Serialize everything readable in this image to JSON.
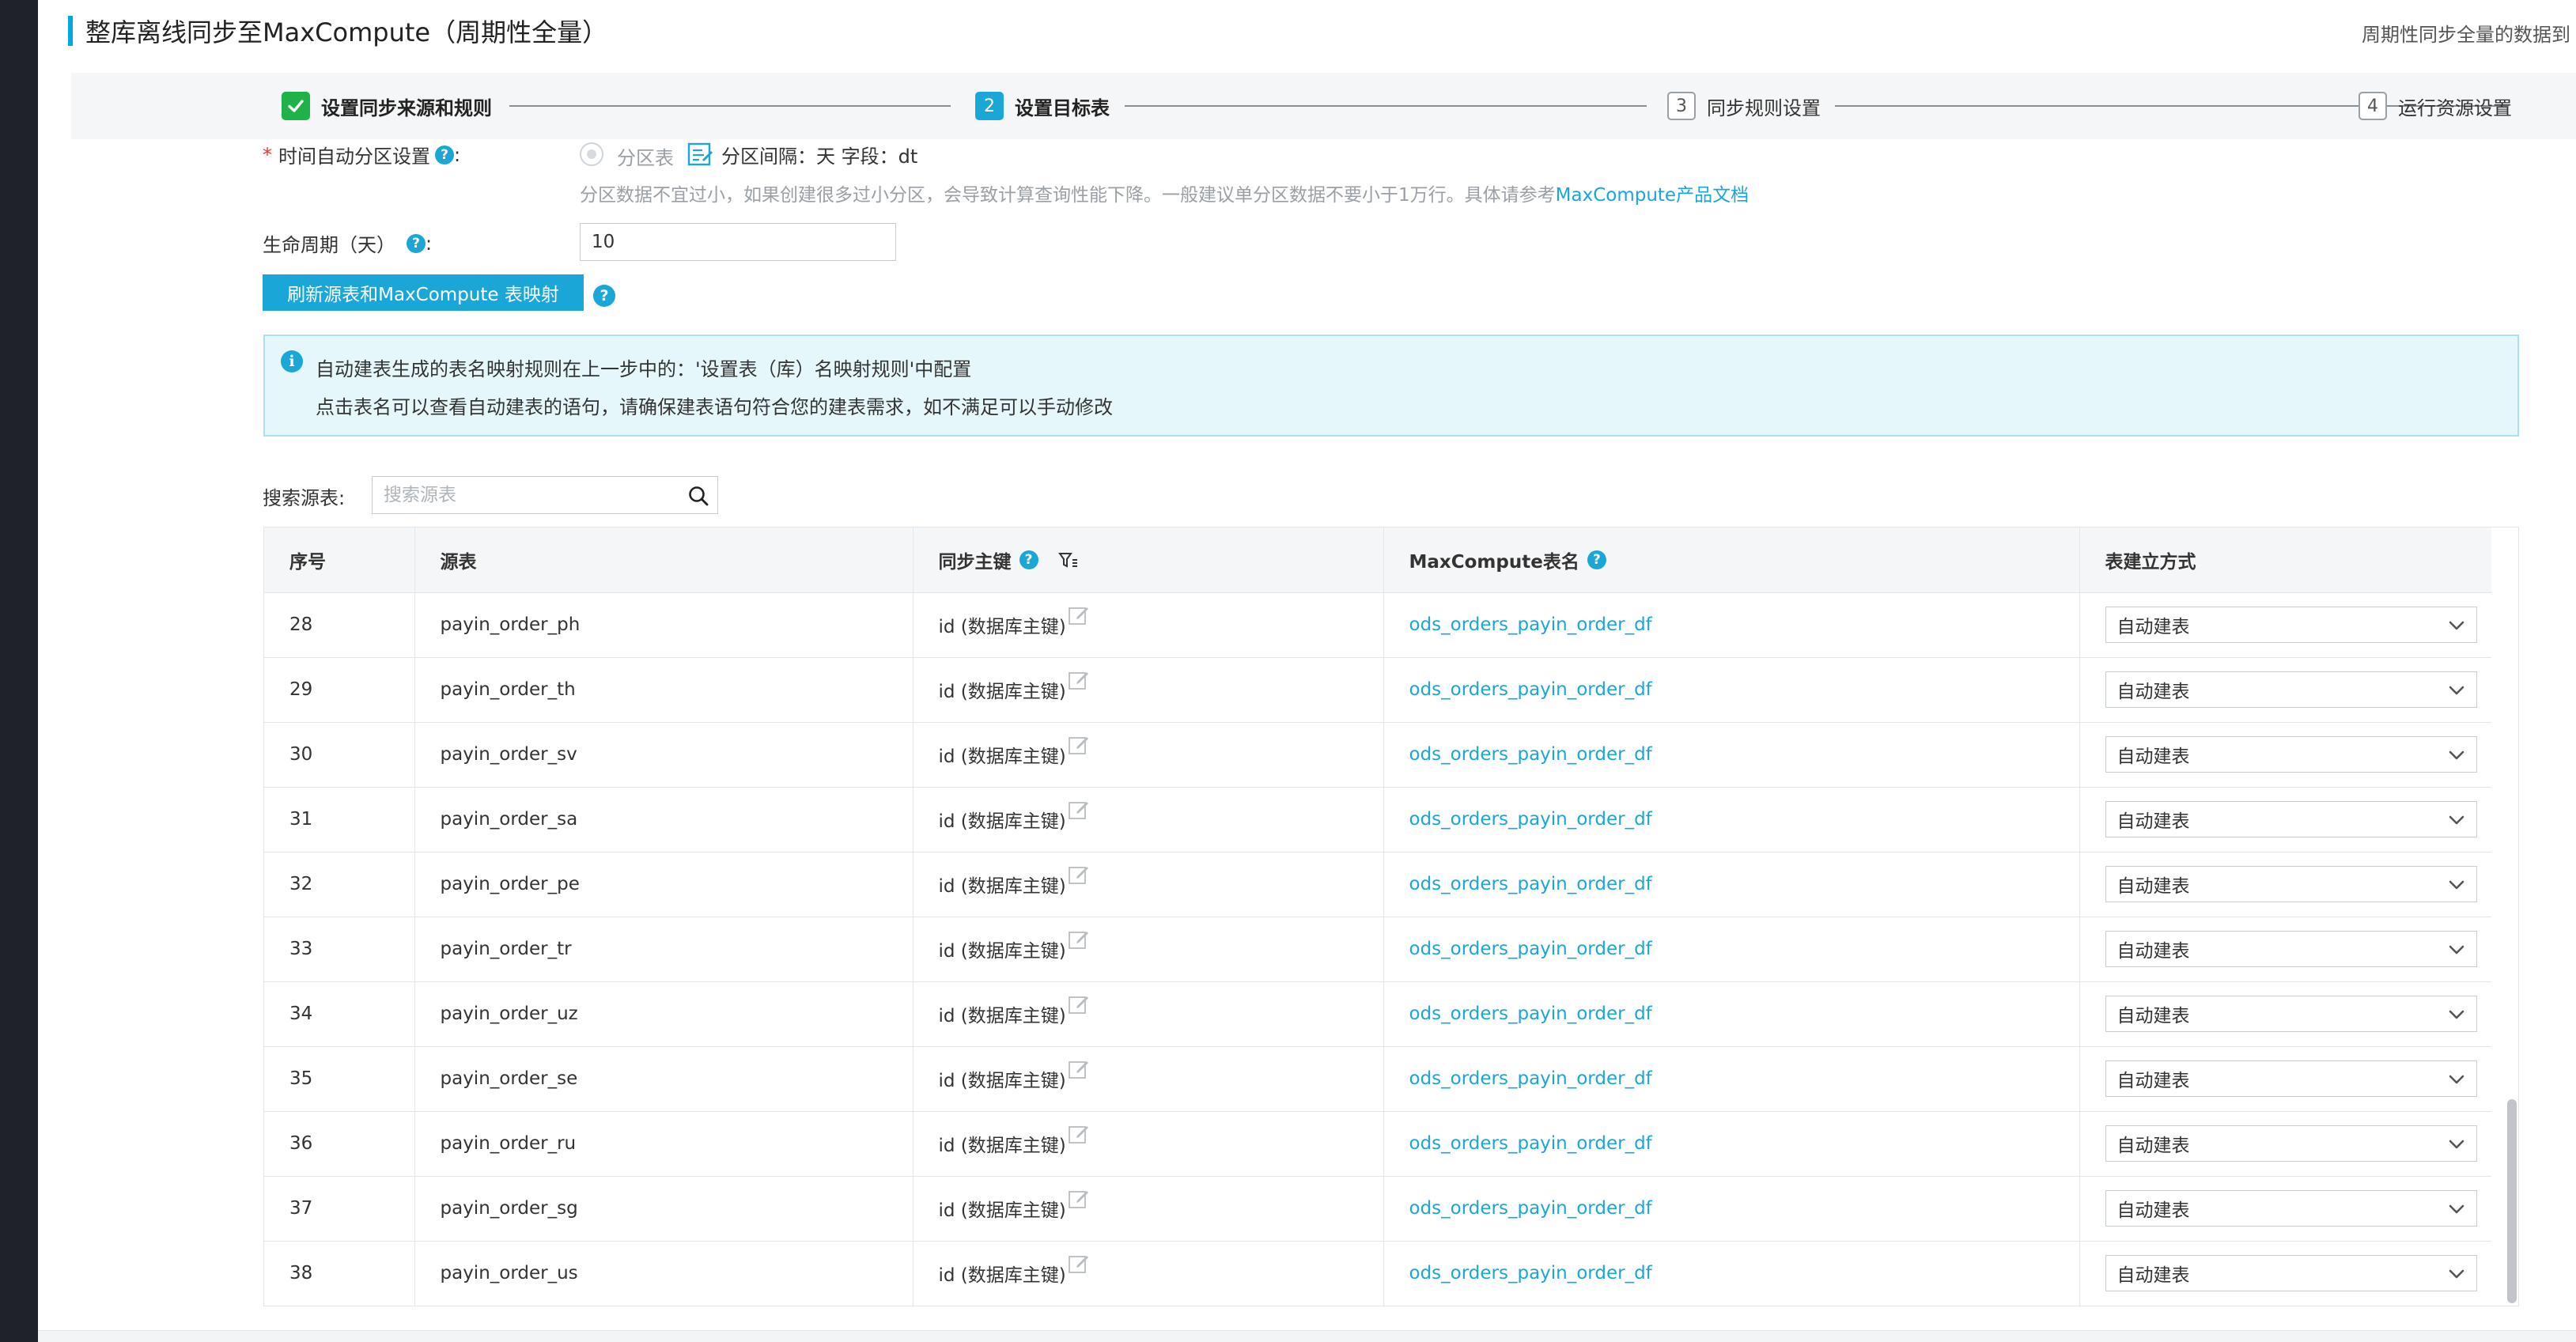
{
  "header": {
    "title": "整库离线同步至MaxCompute（周期性全量）",
    "description": "周期性同步全量的数据到"
  },
  "steps": [
    {
      "number": "",
      "label": "设置同步来源和规则",
      "state": "done"
    },
    {
      "number": "2",
      "label": "设置目标表",
      "state": "active"
    },
    {
      "number": "3",
      "label": "同步规则设置",
      "state": "idle"
    },
    {
      "number": "4",
      "label": "运行资源设置",
      "state": "idle"
    }
  ],
  "form": {
    "partition": {
      "required_mark": "*",
      "label": "时间自动分区设置",
      "colon": ":",
      "radio_label": "分区表",
      "info": "分区间隔：天   字段：dt",
      "tip_text": "分区数据不宜过小，如果创建很多过小分区，会导致计算查询性能下降。一般建议单分区数据不要小于1万行。具体请参考",
      "tip_link": "MaxCompute产品文档"
    },
    "lifecycle": {
      "label": "生命周期（天）",
      "colon": ":",
      "value": "10"
    },
    "refresh_button": "刷新源表和MaxCompute 表映射",
    "help_glyph": "?"
  },
  "alert": {
    "icon_glyph": "i",
    "line1": "自动建表生成的表名映射规则在上一步中的：'设置表（库）名映射规则'中配置",
    "line2": "点击表名可以查看自动建表的语句，请确保建表语句符合您的建表需求，如不满足可以手动修改"
  },
  "search": {
    "label": "搜索源表:",
    "placeholder": "搜索源表",
    "value": ""
  },
  "table": {
    "columns": {
      "index": "序号",
      "source": "源表",
      "pk": "同步主键",
      "target": "MaxCompute表名",
      "mode": "表建立方式"
    },
    "rows": [
      {
        "index": "28",
        "source": "payin_order_ph",
        "pk": "id (数据库主键)",
        "target": "ods_orders_payin_order_df",
        "mode": "自动建表"
      },
      {
        "index": "29",
        "source": "payin_order_th",
        "pk": "id (数据库主键)",
        "target": "ods_orders_payin_order_df",
        "mode": "自动建表"
      },
      {
        "index": "30",
        "source": "payin_order_sv",
        "pk": "id (数据库主键)",
        "target": "ods_orders_payin_order_df",
        "mode": "自动建表"
      },
      {
        "index": "31",
        "source": "payin_order_sa",
        "pk": "id (数据库主键)",
        "target": "ods_orders_payin_order_df",
        "mode": "自动建表"
      },
      {
        "index": "32",
        "source": "payin_order_pe",
        "pk": "id (数据库主键)",
        "target": "ods_orders_payin_order_df",
        "mode": "自动建表"
      },
      {
        "index": "33",
        "source": "payin_order_tr",
        "pk": "id (数据库主键)",
        "target": "ods_orders_payin_order_df",
        "mode": "自动建表"
      },
      {
        "index": "34",
        "source": "payin_order_uz",
        "pk": "id (数据库主键)",
        "target": "ods_orders_payin_order_df",
        "mode": "自动建表"
      },
      {
        "index": "35",
        "source": "payin_order_se",
        "pk": "id (数据库主键)",
        "target": "ods_orders_payin_order_df",
        "mode": "自动建表"
      },
      {
        "index": "36",
        "source": "payin_order_ru",
        "pk": "id (数据库主键)",
        "target": "ods_orders_payin_order_df",
        "mode": "自动建表"
      },
      {
        "index": "37",
        "source": "payin_order_sg",
        "pk": "id (数据库主键)",
        "target": "ods_orders_payin_order_df",
        "mode": "自动建表"
      },
      {
        "index": "38",
        "source": "payin_order_us",
        "pk": "id (数据库主键)",
        "target": "ods_orders_payin_order_df",
        "mode": "自动建表"
      }
    ]
  },
  "icons": {
    "step_done": "check-icon",
    "partition_edit": "edit-icon",
    "help": "help-icon",
    "info": "info-icon",
    "search": "search-icon",
    "filter": "filter-icon",
    "pk_edit": "edit-icon",
    "select": "chevron-down-icon"
  },
  "colors": {
    "accent": "#1aa6d6",
    "success": "#20b24a",
    "required": "#e53935",
    "alert_bg": "#e6f7fb"
  }
}
